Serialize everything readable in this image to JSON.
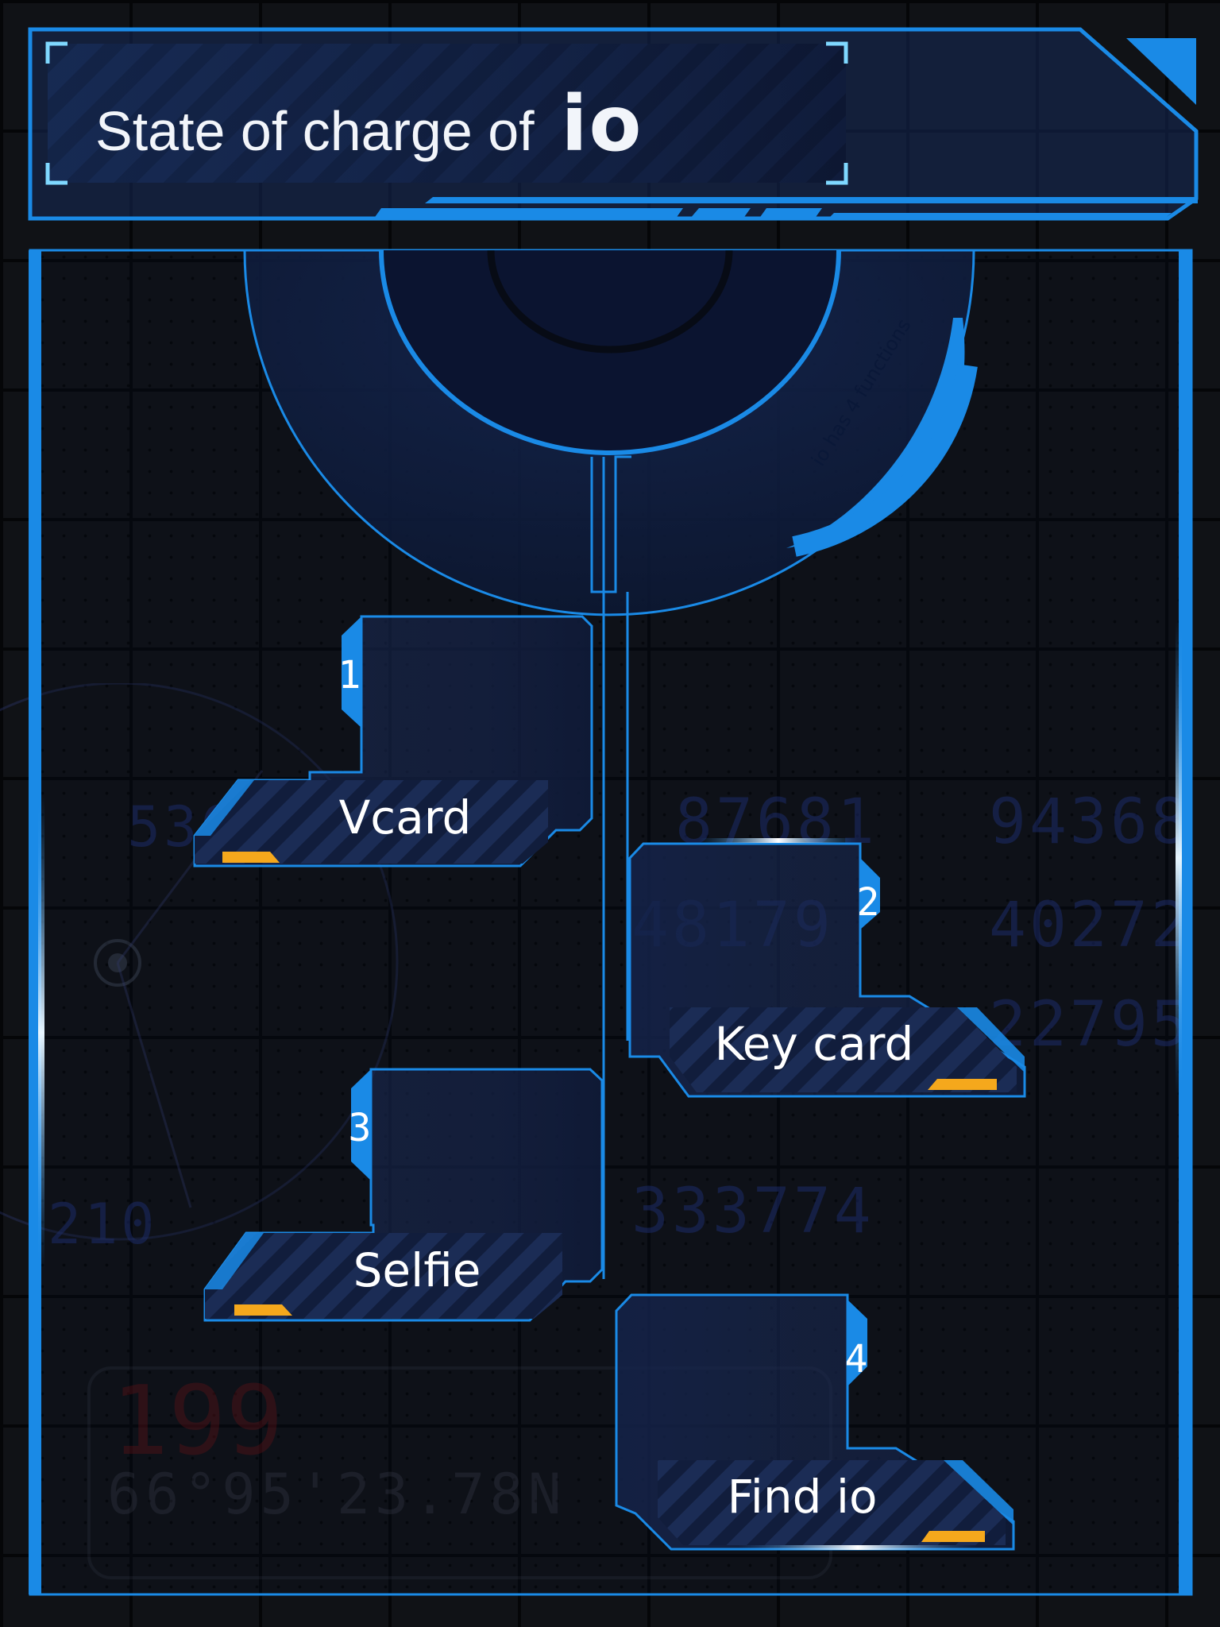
{
  "header": {
    "title": "State of charge of",
    "brand": "io"
  },
  "ring": {
    "caption": "io has 4 functions"
  },
  "functions": [
    {
      "number": "1",
      "label": "Vcard"
    },
    {
      "number": "2",
      "label": "Key card"
    },
    {
      "number": "3",
      "label": "Selfie"
    },
    {
      "number": "4",
      "label": "Find io"
    }
  ],
  "background_numbers": [
    "87681",
    "94368",
    "48179",
    "40272",
    "22795",
    "333774",
    "536",
    "210",
    "199",
    "66°95'23.78N"
  ],
  "colors": {
    "accent_blue": "#1a8ae6",
    "panel_navy": "#13264a",
    "highlight_orange": "#f5a81c",
    "background": "#0c0e12"
  }
}
